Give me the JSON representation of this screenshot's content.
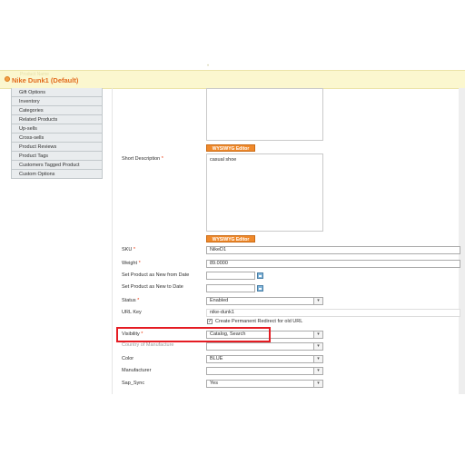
{
  "header": {
    "ghost_title": "Product Name",
    "title": "Nike Dunk1 (Default)"
  },
  "sidebar": {
    "items": [
      {
        "label": "Gift Options"
      },
      {
        "label": "Inventory"
      },
      {
        "label": "Categories"
      },
      {
        "label": "Related Products"
      },
      {
        "label": "Up-sells"
      },
      {
        "label": "Cross-sells"
      },
      {
        "label": "Product Reviews"
      },
      {
        "label": "Product Tags"
      },
      {
        "label": "Customers Tagged Product"
      },
      {
        "label": "Custom Options"
      }
    ]
  },
  "form": {
    "wysiwyg_label": "WYSIWYG Editor",
    "short_description_label": "Short Description",
    "short_description_value": "casual shoe",
    "sku_label": "SKU",
    "sku_value": "NikeD1",
    "weight_label": "Weight",
    "weight_value": "89.0000",
    "new_from_label": "Set Product as New from Date",
    "new_from_value": "",
    "new_to_label": "Set Product as New to Date",
    "new_to_value": "",
    "status_label": "Status",
    "status_value": "Enabled",
    "url_key_label": "URL Key",
    "url_key_value": "nike-dunk1",
    "redirect_label": "Create Permanent Redirect for old URL",
    "redirect_checked": true,
    "visibility_label": "Visibility",
    "visibility_value": "Catalog, Search",
    "country_label": "Country of Manufacture",
    "country_value": "",
    "color_label": "Color",
    "color_value": "BLUE",
    "manufacturer_label": "Manufacturer",
    "manufacturer_value": "",
    "sap_sync_label": "Sap_Sync",
    "sap_sync_value": "Yes",
    "required_mark": "*"
  },
  "colors": {
    "header_bg": "#fbf7cf",
    "title": "#e26b1d",
    "wysiwyg_button": "#f08a2c",
    "highlight": "#e51c23",
    "required": "#eb340a"
  },
  "icons": {
    "product": "product-icon",
    "calendar": "calendar-icon",
    "dropdown": "chevron-down-icon"
  }
}
